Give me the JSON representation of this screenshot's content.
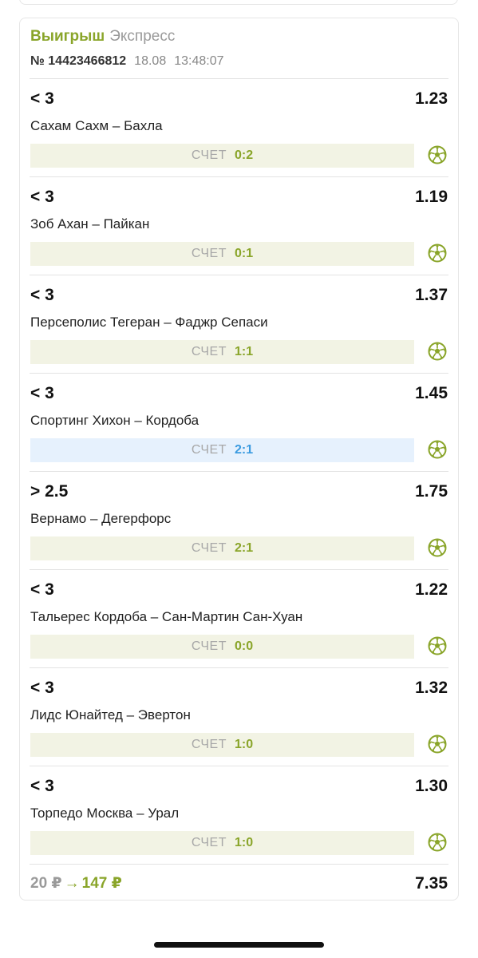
{
  "header": {
    "status": "Выигрыш",
    "type": "Экспресс",
    "number": "№ 14423466812",
    "date": "18.08",
    "time": "13:48:07"
  },
  "bets": [
    {
      "outcome": "< 3",
      "odds": "1.23",
      "match": "Сахам Сахм – Бахла",
      "score_label": "СЧЕТ",
      "score": "0:2",
      "live": false
    },
    {
      "outcome": "< 3",
      "odds": "1.19",
      "match": "Зоб Ахан – Пайкан",
      "score_label": "СЧЕТ",
      "score": "0:1",
      "live": false
    },
    {
      "outcome": "< 3",
      "odds": "1.37",
      "match": "Персеполис Тегеран – Фаджр Сепаси",
      "score_label": "СЧЕТ",
      "score": "1:1",
      "live": false
    },
    {
      "outcome": "< 3",
      "odds": "1.45",
      "match": "Спортинг Хихон – Кордоба",
      "score_label": "СЧЕТ",
      "score": "2:1",
      "live": true
    },
    {
      "outcome": "> 2.5",
      "odds": "1.75",
      "match": "Вернамо – Дегерфорс",
      "score_label": "СЧЕТ",
      "score": "2:1",
      "live": false
    },
    {
      "outcome": "< 3",
      "odds": "1.22",
      "match": "Тальерес Кордоба – Сан-Мартин Сан-Хуан",
      "score_label": "СЧЕТ",
      "score": "0:0",
      "live": false
    },
    {
      "outcome": "< 3",
      "odds": "1.32",
      "match": "Лидс Юнайтед – Эвертон",
      "score_label": "СЧЕТ",
      "score": "1:0",
      "live": false
    },
    {
      "outcome": "< 3",
      "odds": "1.30",
      "match": "Торпедо Москва – Урал",
      "score_label": "СЧЕТ",
      "score": "1:0",
      "live": false
    }
  ],
  "footer": {
    "stake": "20 ₽",
    "arrow": "→",
    "payout": "147 ₽",
    "total_odds": "7.35"
  },
  "icons": {
    "sport": "soccer-ball-icon",
    "arrow": "arrow-right-icon"
  },
  "colors": {
    "win_green": "#8aa52a",
    "score_bg": "#f2f3e4",
    "live_bg": "#e6f1fd",
    "live_blue": "#3b9be0"
  }
}
